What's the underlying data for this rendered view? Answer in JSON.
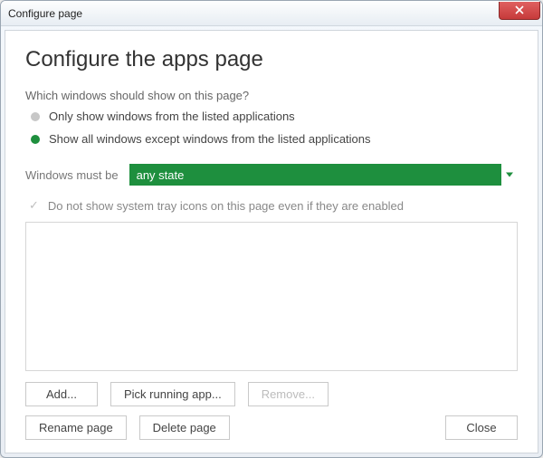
{
  "window": {
    "title": "Configure page"
  },
  "header": {
    "title": "Configure the apps page"
  },
  "question": "Which windows should show on this page?",
  "radios": {
    "only": {
      "label": "Only show windows from the listed applications",
      "checked": false
    },
    "except": {
      "label": "Show all windows except windows from the listed applications",
      "checked": true
    }
  },
  "state_row": {
    "label": "Windows must be",
    "selected": "any state"
  },
  "tray_checkbox": {
    "checked": true,
    "label": "Do not show system tray icons on this page even if they are enabled"
  },
  "buttons": {
    "add": "Add...",
    "pick": "Pick running app...",
    "remove": "Remove...",
    "rename": "Rename page",
    "delete": "Delete page",
    "close": "Close"
  }
}
